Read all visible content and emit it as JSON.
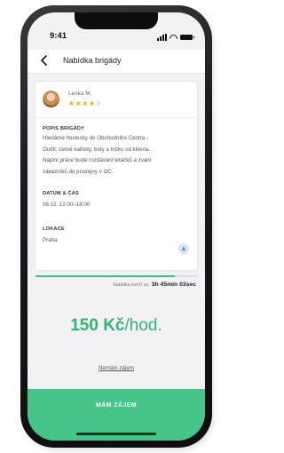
{
  "status_bar": {
    "time": "9:41"
  },
  "header": {
    "title": "Nabídka brigády"
  },
  "employer": {
    "name": "Lenka M.",
    "rating": 4,
    "rating_max": 5
  },
  "description": {
    "label": "POPIS BRIGÁDY",
    "line1": "Hledáme hostesky do Obchodního Centra -",
    "line2": "Outfit: černé kalhoty, boty a tričko od klienta.",
    "line3": "Náplní práce bude rozdávání letáčků a zvaní",
    "line4": "zákazníků do prodejny v OC."
  },
  "datetime": {
    "label": "DATUM & ČAS",
    "value": "06.12. 12:00–18:00"
  },
  "location": {
    "label": "LOKACE",
    "value": "Praha",
    "nav_icon": "navigation-arrow-icon"
  },
  "countdown": {
    "label": "Nabídka končí za",
    "value": "3h 45min 03sec",
    "progress": 0.86
  },
  "price": {
    "amount": "150 Kč",
    "unit": "/hod."
  },
  "actions": {
    "no_interest": "Nemám zájem",
    "interested": "MÁM ZÁJEM"
  },
  "colors": {
    "accent_green": "#47c48a",
    "price_green": "#2fb676",
    "star": "#f5b301"
  }
}
